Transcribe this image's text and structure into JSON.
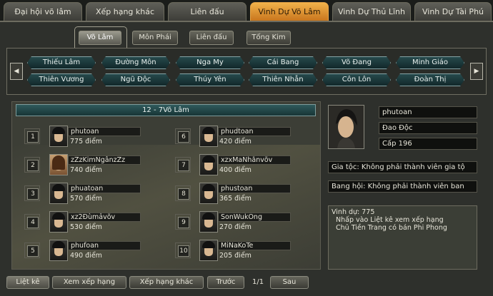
{
  "top_tabs": [
    "Đại hội võ lâm",
    "Xếp hạng khác",
    "Liên đấu",
    "Vinh Dự Võ Lâm",
    "Vinh Dự Thủ Lĩnh",
    "Vinh Dự Tài Phú"
  ],
  "sub_tabs": [
    "Võ Lâm",
    "Môn Phái",
    "Liên đấu",
    "Tống Kim"
  ],
  "factions": [
    "Thiếu Lâm",
    "Đường Môn",
    "Nga My",
    "Cái Bang",
    "Võ Đang",
    "Minh Giáo",
    "Thiên Vương",
    "Ngũ Độc",
    "Thúy Yên",
    "Thiên Nhẫn",
    "Côn Lôn",
    "Đoàn Thị"
  ],
  "ranking_title": "12 - 7Võ Lâm",
  "players": [
    {
      "rank": "1",
      "name": "phutoan",
      "score": "775 điểm"
    },
    {
      "rank": "2",
      "name": "zZzKimNgânzZz",
      "score": "740 điểm"
    },
    {
      "rank": "3",
      "name": "phuatoan",
      "score": "570 điểm"
    },
    {
      "rank": "4",
      "name": "xz2Đùmảvõv",
      "score": "530 điểm"
    },
    {
      "rank": "5",
      "name": "phufoan",
      "score": "490 điểm"
    },
    {
      "rank": "6",
      "name": "phudtoan",
      "score": "420 điểm"
    },
    {
      "rank": "7",
      "name": "xzxMaNhẫnvõv",
      "score": "400 điểm"
    },
    {
      "rank": "8",
      "name": "phustoan",
      "score": "365 điểm"
    },
    {
      "rank": "9",
      "name": "SonWukOng",
      "score": "270 điểm"
    },
    {
      "rank": "10",
      "name": "MiNaKoTe",
      "score": "205 điểm"
    }
  ],
  "detail": {
    "name": "phutoan",
    "faction": "Đao Độc",
    "level": "Cấp 196",
    "clan": "Gia tộc: Không phải thành viên gia tộ",
    "guild": "Bang hội: Không phải thành viên ban",
    "honor_lines": [
      "Vinh dự: 775",
      "Nhấp vào Liệt kê xem xếp hạng",
      "Chủ Tiền Trang có bán Phi Phong"
    ]
  },
  "bottom": {
    "list_label": "Liệt kê",
    "view_rank_label": "Xem xếp hạng",
    "other_rank_label": "Xếp hạng khác",
    "prev_label": "Trước",
    "page": "1/1",
    "next_label": "Sau"
  }
}
